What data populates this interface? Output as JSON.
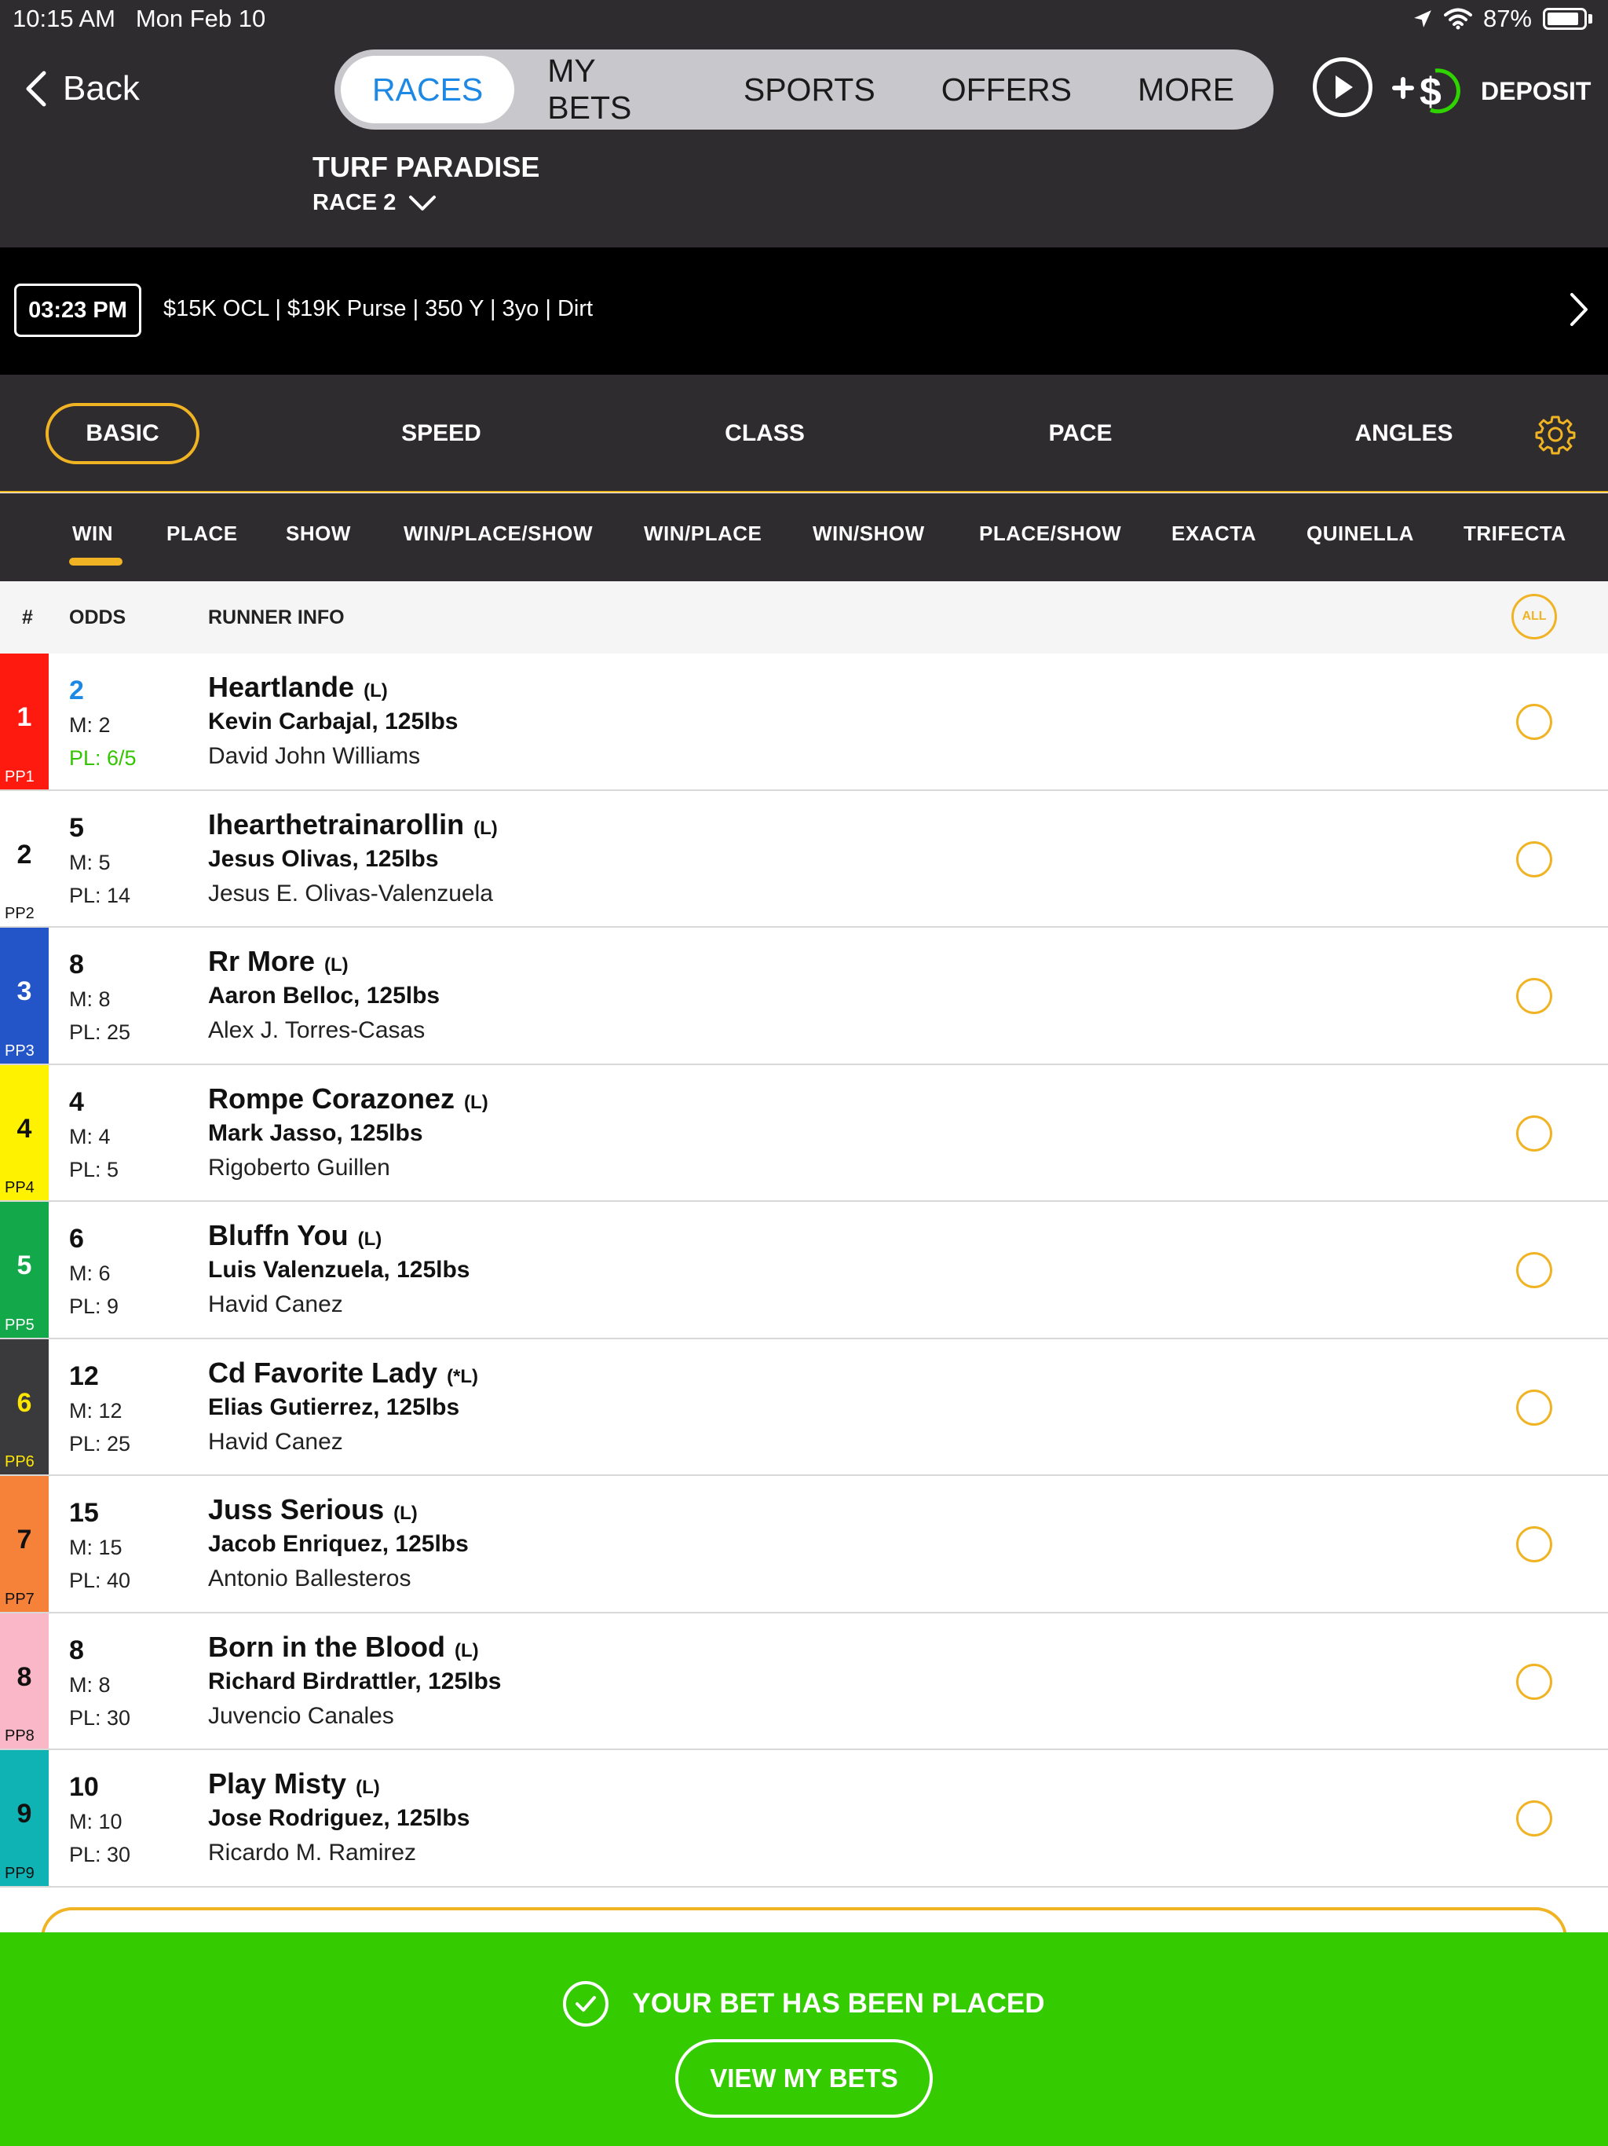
{
  "status": {
    "time": "10:15 AM",
    "date": "Mon Feb 10",
    "battery": "87%"
  },
  "header": {
    "back_label": "Back",
    "nav_tabs": [
      "RACES",
      "MY BETS",
      "SPORTS",
      "OFFERS",
      "MORE"
    ],
    "active_tab": "RACES",
    "deposit_label": "DEPOSIT",
    "track": "TURF PARADISE",
    "race": "RACE 2"
  },
  "race_info": {
    "post_time": "03:23 PM",
    "description": "$15K OCL | $19K Purse | 350 Y | 3yo | Dirt"
  },
  "handicap_tabs": [
    "BASIC",
    "SPEED",
    "CLASS",
    "PACE",
    "ANGLES"
  ],
  "bet_types": [
    "WIN",
    "PLACE",
    "SHOW",
    "WIN/PLACE/SHOW",
    "WIN/PLACE",
    "WIN/SHOW",
    "PLACE/SHOW",
    "EXACTA",
    "QUINELLA",
    "TRIFECTA"
  ],
  "table_headers": {
    "num": "#",
    "odds": "ODDS",
    "runner": "RUNNER INFO",
    "all": "ALL"
  },
  "runners": [
    {
      "num": "1",
      "pp": "PP1",
      "odds": "2",
      "ml": "M: 2",
      "pl": "PL: 6/5",
      "horse": "Heartlande",
      "med": "(L)",
      "jockey": "Kevin Carbajal, 125lbs",
      "trainer": "David John Williams"
    },
    {
      "num": "2",
      "pp": "PP2",
      "odds": "5",
      "ml": "M: 5",
      "pl": "PL: 14",
      "horse": "Ihearthetrainarollin",
      "med": "(L)",
      "jockey": "Jesus Olivas, 125lbs",
      "trainer": "Jesus E. Olivas-Valenzuela"
    },
    {
      "num": "3",
      "pp": "PP3",
      "odds": "8",
      "ml": "M: 8",
      "pl": "PL: 25",
      "horse": "Rr More",
      "med": "(L)",
      "jockey": "Aaron Belloc, 125lbs",
      "trainer": "Alex J. Torres-Casas"
    },
    {
      "num": "4",
      "pp": "PP4",
      "odds": "4",
      "ml": "M: 4",
      "pl": "PL: 5",
      "horse": "Rompe Corazonez",
      "med": "(L)",
      "jockey": "Mark Jasso, 125lbs",
      "trainer": "Rigoberto Guillen"
    },
    {
      "num": "5",
      "pp": "PP5",
      "odds": "6",
      "ml": "M: 6",
      "pl": "PL: 9",
      "horse": "Bluffn You",
      "med": "(L)",
      "jockey": "Luis Valenzuela, 125lbs",
      "trainer": "Havid Canez"
    },
    {
      "num": "6",
      "pp": "PP6",
      "odds": "12",
      "ml": "M: 12",
      "pl": "PL: 25",
      "horse": "Cd Favorite Lady",
      "med": "(*L)",
      "jockey": "Elias Gutierrez, 125lbs",
      "trainer": "Havid Canez"
    },
    {
      "num": "7",
      "pp": "PP7",
      "odds": "15",
      "ml": "M: 15",
      "pl": "PL: 40",
      "horse": "Juss Serious",
      "med": "(L)",
      "jockey": "Jacob Enriquez, 125lbs",
      "trainer": "Antonio Ballesteros"
    },
    {
      "num": "8",
      "pp": "PP8",
      "odds": "8",
      "ml": "M: 8",
      "pl": "PL: 30",
      "horse": "Born in the Blood",
      "med": "(L)",
      "jockey": "Richard Birdrattler, 125lbs",
      "trainer": "Juvencio Canales"
    },
    {
      "num": "9",
      "pp": "PP9",
      "odds": "10",
      "ml": "M: 10",
      "pl": "PL: 30",
      "horse": "Play Misty",
      "med": "(L)",
      "jockey": "Jose Rodriguez, 125lbs",
      "trainer": "Ricardo M. Ramirez"
    }
  ],
  "saddle_colors": [
    {
      "bg": "#ff1a10",
      "fg": "#ffffff"
    },
    {
      "bg": "#ffffff",
      "fg": "#111111"
    },
    {
      "bg": "#2355c8",
      "fg": "#ffffff"
    },
    {
      "bg": "#fff200",
      "fg": "#111111"
    },
    {
      "bg": "#13a84a",
      "fg": "#ffffff"
    },
    {
      "bg": "#3a3a3d",
      "fg": "#ffe600"
    },
    {
      "bg": "#f6823a",
      "fg": "#111111"
    },
    {
      "bg": "#f9b7c7",
      "fg": "#111111"
    },
    {
      "bg": "#10b3b3",
      "fg": "#111111"
    }
  ],
  "colors": {
    "accent": "#f0b323",
    "active_blue": "#1e88e5",
    "favorite_green": "#34c400",
    "toast_green": "#34cc00"
  },
  "toast": {
    "message": "YOUR BET HAS BEEN PLACED",
    "button": "VIEW MY BETS"
  }
}
